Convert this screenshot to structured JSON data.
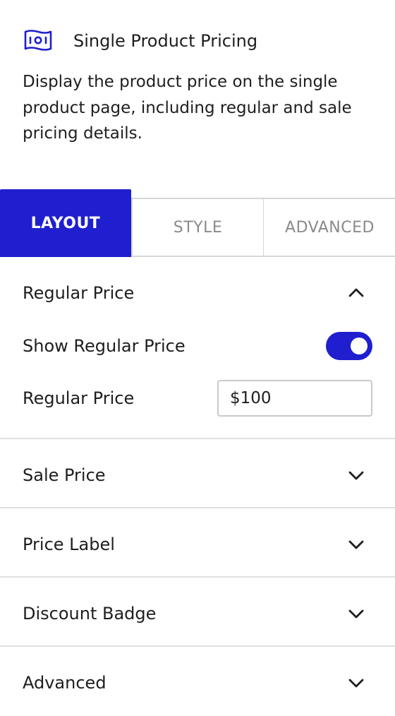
{
  "header": {
    "icon": "money-bill-icon",
    "title": "Single Product Pricing",
    "description": "Display the product price on the single product page, including regular and sale pricing details."
  },
  "tabs": [
    {
      "label": "LAYOUT",
      "active": true
    },
    {
      "label": "STYLE",
      "active": false
    },
    {
      "label": "ADVANCED",
      "active": false
    }
  ],
  "sections": {
    "regular_price": {
      "title": "Regular Price",
      "expanded": true,
      "show_toggle_label": "Show Regular Price",
      "show_toggle_on": true,
      "price_label": "Regular Price",
      "price_value": "$100"
    },
    "collapsed": [
      {
        "title": "Sale Price"
      },
      {
        "title": "Price Label"
      },
      {
        "title": "Discount Badge"
      },
      {
        "title": "Advanced"
      }
    ]
  },
  "colors": {
    "accent": "#1f1fcf",
    "divider": "#e0e0e0",
    "tab_inactive_text": "#8a8a8a"
  }
}
